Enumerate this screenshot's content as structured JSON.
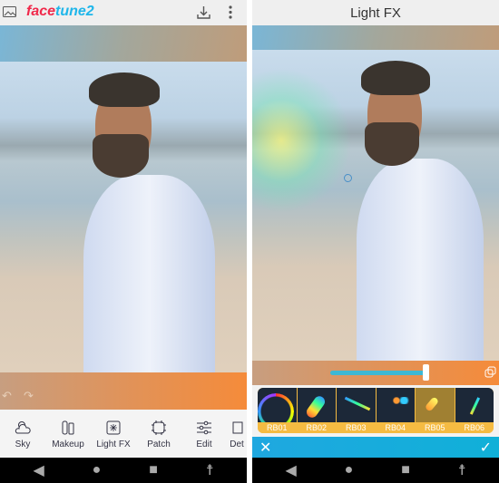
{
  "left": {
    "logo": {
      "part1": "face",
      "part2": "tune2",
      "color1": "#f0284a",
      "color2": "#1fb6ea"
    },
    "icons": [
      "gallery-icon",
      "download-icon",
      "more-vert-icon",
      "undo-icon",
      "redo-icon"
    ],
    "tools": [
      {
        "label": "Sky",
        "icon": "sky-icon"
      },
      {
        "label": "Makeup",
        "icon": "makeup-icon"
      },
      {
        "label": "Light FX",
        "icon": "light-fx-icon"
      },
      {
        "label": "Patch",
        "icon": "patch-icon"
      },
      {
        "label": "Edit",
        "icon": "sliders-icon"
      },
      {
        "label": "Det",
        "icon": "details-icon"
      }
    ]
  },
  "right": {
    "title": "Light FX",
    "slider_value": 0.78,
    "presets": [
      {
        "label": "RB01",
        "selected": false
      },
      {
        "label": "RB02",
        "selected": false
      },
      {
        "label": "RB03",
        "selected": false
      },
      {
        "label": "RB04",
        "selected": false
      },
      {
        "label": "RB05",
        "selected": true
      },
      {
        "label": "RB06",
        "selected": false
      }
    ],
    "cancel": "✕",
    "confirm": "✓"
  },
  "nav": {
    "back": "◀",
    "home": "●",
    "recents": "■",
    "accessibility": "☨"
  }
}
